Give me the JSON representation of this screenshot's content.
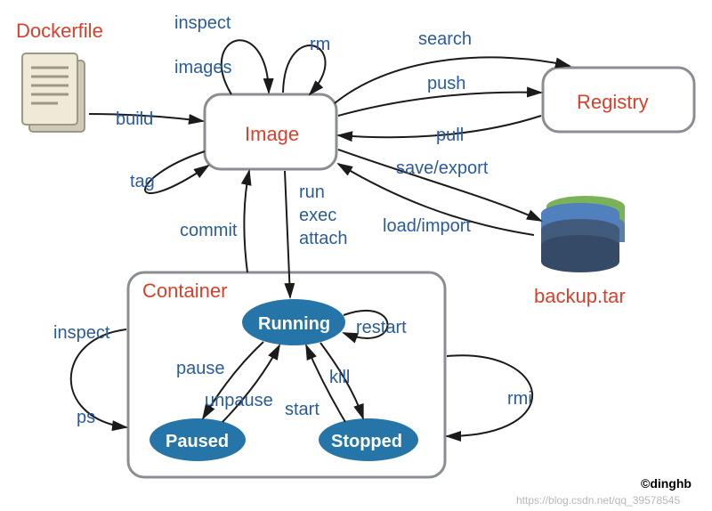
{
  "nodes": {
    "dockerfile": "Dockerfile",
    "image": "Image",
    "registry": "Registry",
    "container": "Container",
    "backup": "backup.tar"
  },
  "states": {
    "running": "Running",
    "paused": "Paused",
    "stopped": "Stopped"
  },
  "commands": {
    "build": "build",
    "inspect_img": "inspect",
    "images": "images",
    "rm": "rm",
    "tag": "tag",
    "run": "run",
    "exec": "exec",
    "attach": "attach",
    "commit": "commit",
    "search": "search",
    "push": "push",
    "pull": "pull",
    "save_export": "save/export",
    "load_import": "load/import",
    "restart": "restart",
    "pause": "pause",
    "unpause": "unpause",
    "kill": "kill",
    "start": "start",
    "inspect_c": "inspect",
    "ps": "ps",
    "rmi": "rmi"
  },
  "credit": "©dinghb",
  "watermark": "https://blog.csdn.net/qq_39578545"
}
